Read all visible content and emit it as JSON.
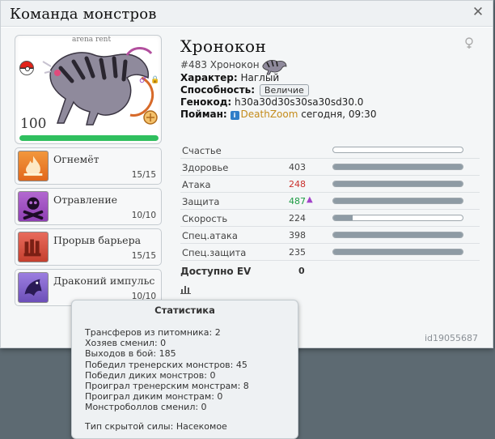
{
  "window": {
    "title": "Команда монстров",
    "close_symbol": "✕",
    "object_id": "id19055687"
  },
  "portrait": {
    "arena_label": "arena rent",
    "level": "100",
    "hp_fraction": 1.0,
    "gender_symbol": "♂",
    "lock_symbol": "🔒"
  },
  "moves": [
    {
      "name": "Огнемёт",
      "pp": "15/15",
      "type": "fire"
    },
    {
      "name": "Отравление",
      "pp": "10/10",
      "type": "poison"
    },
    {
      "name": "Прорыв барьера",
      "pp": "15/15",
      "type": "fighting"
    },
    {
      "name": "Драконий импульс",
      "pp": "10/10",
      "type": "dragon"
    }
  ],
  "monster": {
    "name": "Хронокон",
    "number_line": "#483 Хронокон",
    "nature_label": "Характер:",
    "nature": "Наглый",
    "ability_label": "Способность:",
    "ability": "Величие",
    "genocode_label": "Генокод:",
    "genocode": "h30a30d30s30sa30sd30.0",
    "caught_label": "Пойман:",
    "trainer": "DeathZoom",
    "caught_time": "сегодня, 09:30"
  },
  "stats": {
    "header": "Счастье",
    "happiness_fraction": 0.0,
    "rows": [
      {
        "label": "Здоровье",
        "value": "403",
        "fill": 1.0,
        "tone": "normal",
        "arrow": ""
      },
      {
        "label": "Атака",
        "value": "248",
        "fill": 1.0,
        "tone": "low",
        "arrow": ""
      },
      {
        "label": "Защита",
        "value": "487",
        "fill": 1.0,
        "tone": "high",
        "arrow": "▲"
      },
      {
        "label": "Скорость",
        "value": "224",
        "fill": 0.15,
        "tone": "normal",
        "arrow": ""
      },
      {
        "label": "Спец.атака",
        "value": "398",
        "fill": 1.0,
        "tone": "normal",
        "arrow": ""
      },
      {
        "label": "Спец.защита",
        "value": "235",
        "fill": 1.0,
        "tone": "normal",
        "arrow": ""
      }
    ],
    "ev_label": "Доступно EV",
    "ev_value": "0"
  },
  "tooltip": {
    "title": "Статистика",
    "lines": [
      "Трансферов из питомника: 2",
      "Хозяев сменил: 0",
      "Выходов в бой: 185",
      "Победил тренерских монстров: 45",
      "Победил диких монстров: 0",
      "Проиграл тренерским монстрам: 8",
      "Проиграл диким монстрам: 0",
      "Монстроболлов сменил: 0"
    ],
    "hidden_power": "Тип скрытой силы: Насекомое"
  }
}
